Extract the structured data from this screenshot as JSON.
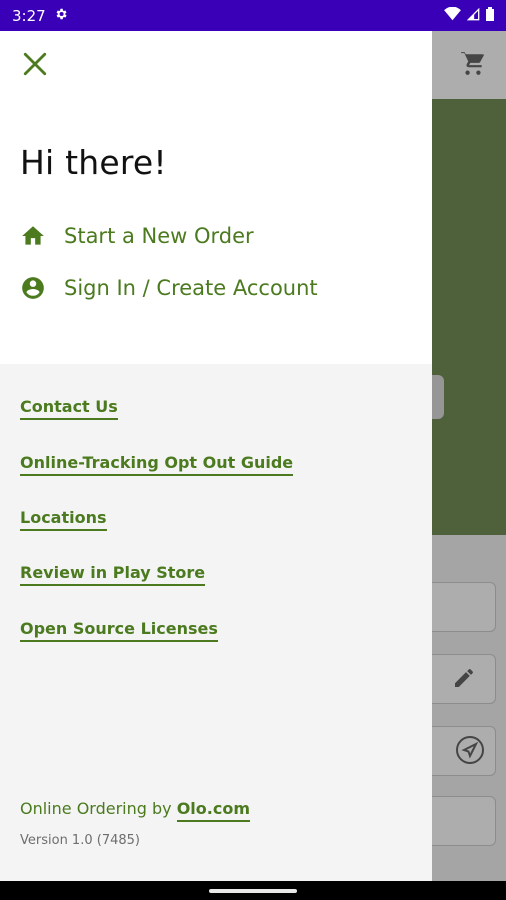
{
  "status_bar": {
    "time": "3:27"
  },
  "drawer": {
    "greeting": "Hi there!",
    "menu": [
      {
        "label": "Start a New Order",
        "icon": "home-icon"
      },
      {
        "label": "Sign In / Create Account",
        "icon": "account-circle-icon"
      }
    ],
    "links": [
      "Contact Us",
      "Online-Tracking Opt Out Guide",
      "Locations",
      "Review in Play Store",
      "Open Source Licenses"
    ],
    "footer": {
      "prefix": "Online Ordering by ",
      "brand": "Olo.com",
      "version": "Version 1.0 (7485)"
    }
  },
  "colors": {
    "accent": "#4b7a1f",
    "status_bar": "#3a00b8",
    "drawer_bg": "#f4f4f4"
  }
}
